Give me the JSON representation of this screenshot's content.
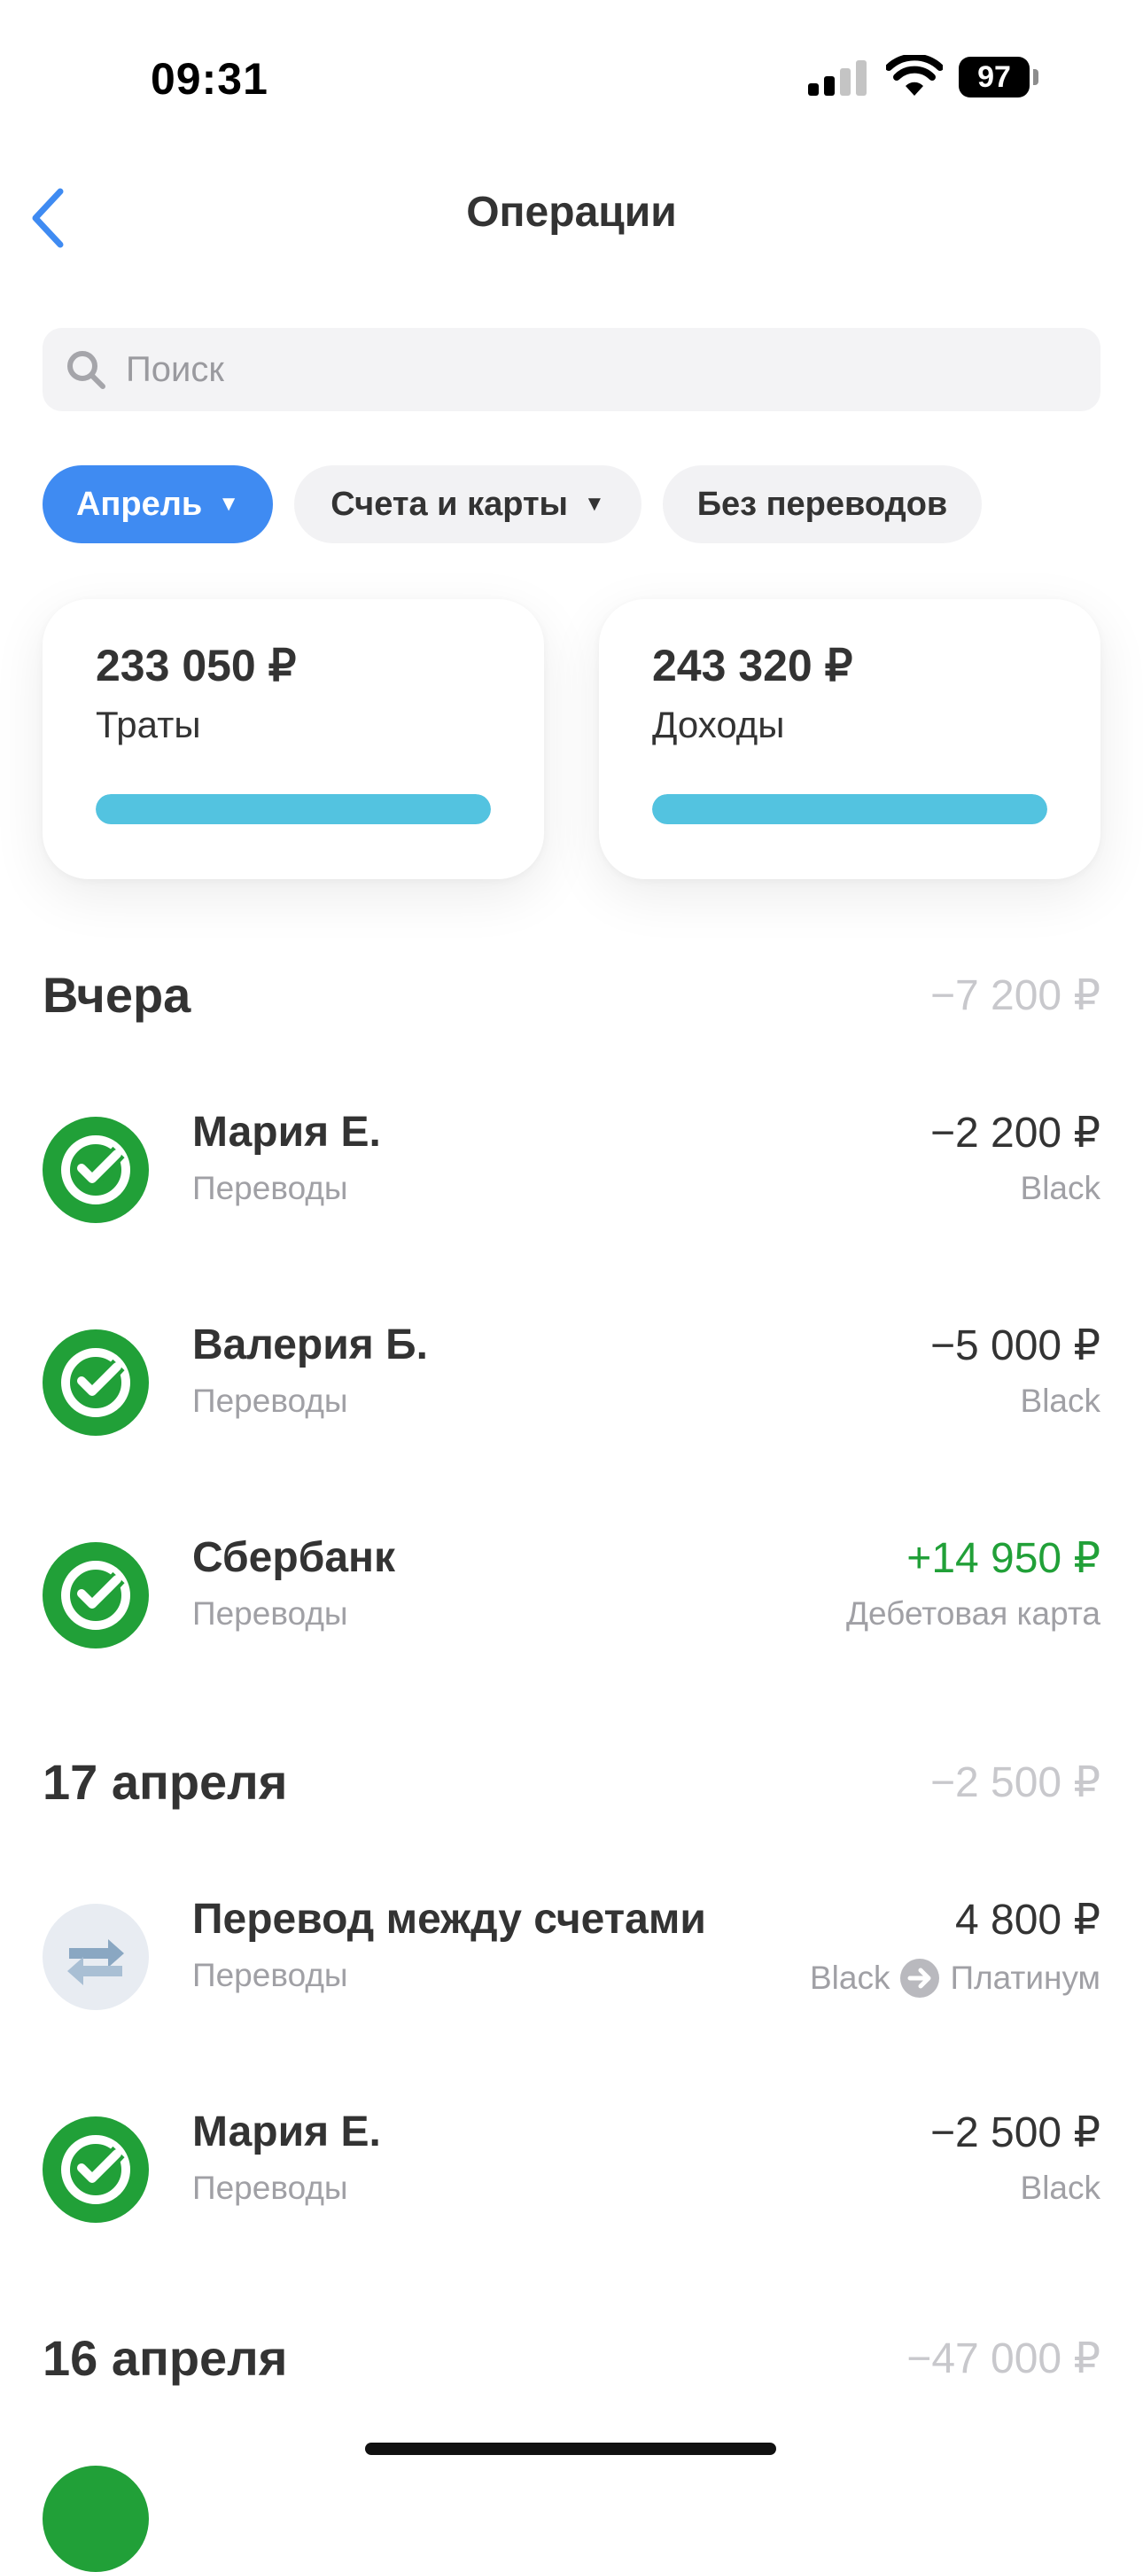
{
  "status_bar": {
    "time": "09:31",
    "battery": "97"
  },
  "header": {
    "title": "Операции"
  },
  "search": {
    "placeholder": "Поиск"
  },
  "filters": {
    "month": "Апрель",
    "accounts": "Счета и карты",
    "no_transfers": "Без переводов"
  },
  "summary": {
    "spend": {
      "amount": "233 050 ₽",
      "label": "Траты",
      "bar_fraction": 1.0,
      "color": "#53c3e0"
    },
    "income": {
      "amount": "243 320 ₽",
      "label": "Доходы",
      "bar_fraction": 1.0,
      "color": "#53c3e0"
    }
  },
  "groups": [
    {
      "title": "Вчера",
      "total": "−7 200 ₽",
      "items": [
        {
          "name": "Мария Е.",
          "category": "Переводы",
          "amount": "−2 200 ₽",
          "account": "Black",
          "icon": "sber-logo-icon"
        },
        {
          "name": "Валерия Б.",
          "category": "Переводы",
          "amount": "−5 000 ₽",
          "account": "Black",
          "icon": "sber-logo-icon"
        },
        {
          "name": "Сбербанк",
          "category": "Переводы",
          "amount": "+14 950 ₽",
          "account": "Дебетовая карта",
          "icon": "sber-logo-icon"
        }
      ]
    },
    {
      "title": "17 апреля",
      "total": "−2 500 ₽",
      "items": [
        {
          "name": "Перевод между счетами",
          "category": "Переводы",
          "amount": "4 800 ₽",
          "account_from": "Black",
          "account_to": "Платинум",
          "icon": "transfer-arrows-icon"
        },
        {
          "name": "Мария Е.",
          "category": "Переводы",
          "amount": "−2 500 ₽",
          "account": "Black",
          "icon": "sber-logo-icon"
        }
      ]
    },
    {
      "title": "16 апреля",
      "total": "−47 000 ₽",
      "items": []
    }
  ],
  "colors": {
    "accent": "#3f8bf2",
    "brand_green": "#21a038",
    "positive": "#21a038",
    "muted": "#a0a0a5"
  }
}
